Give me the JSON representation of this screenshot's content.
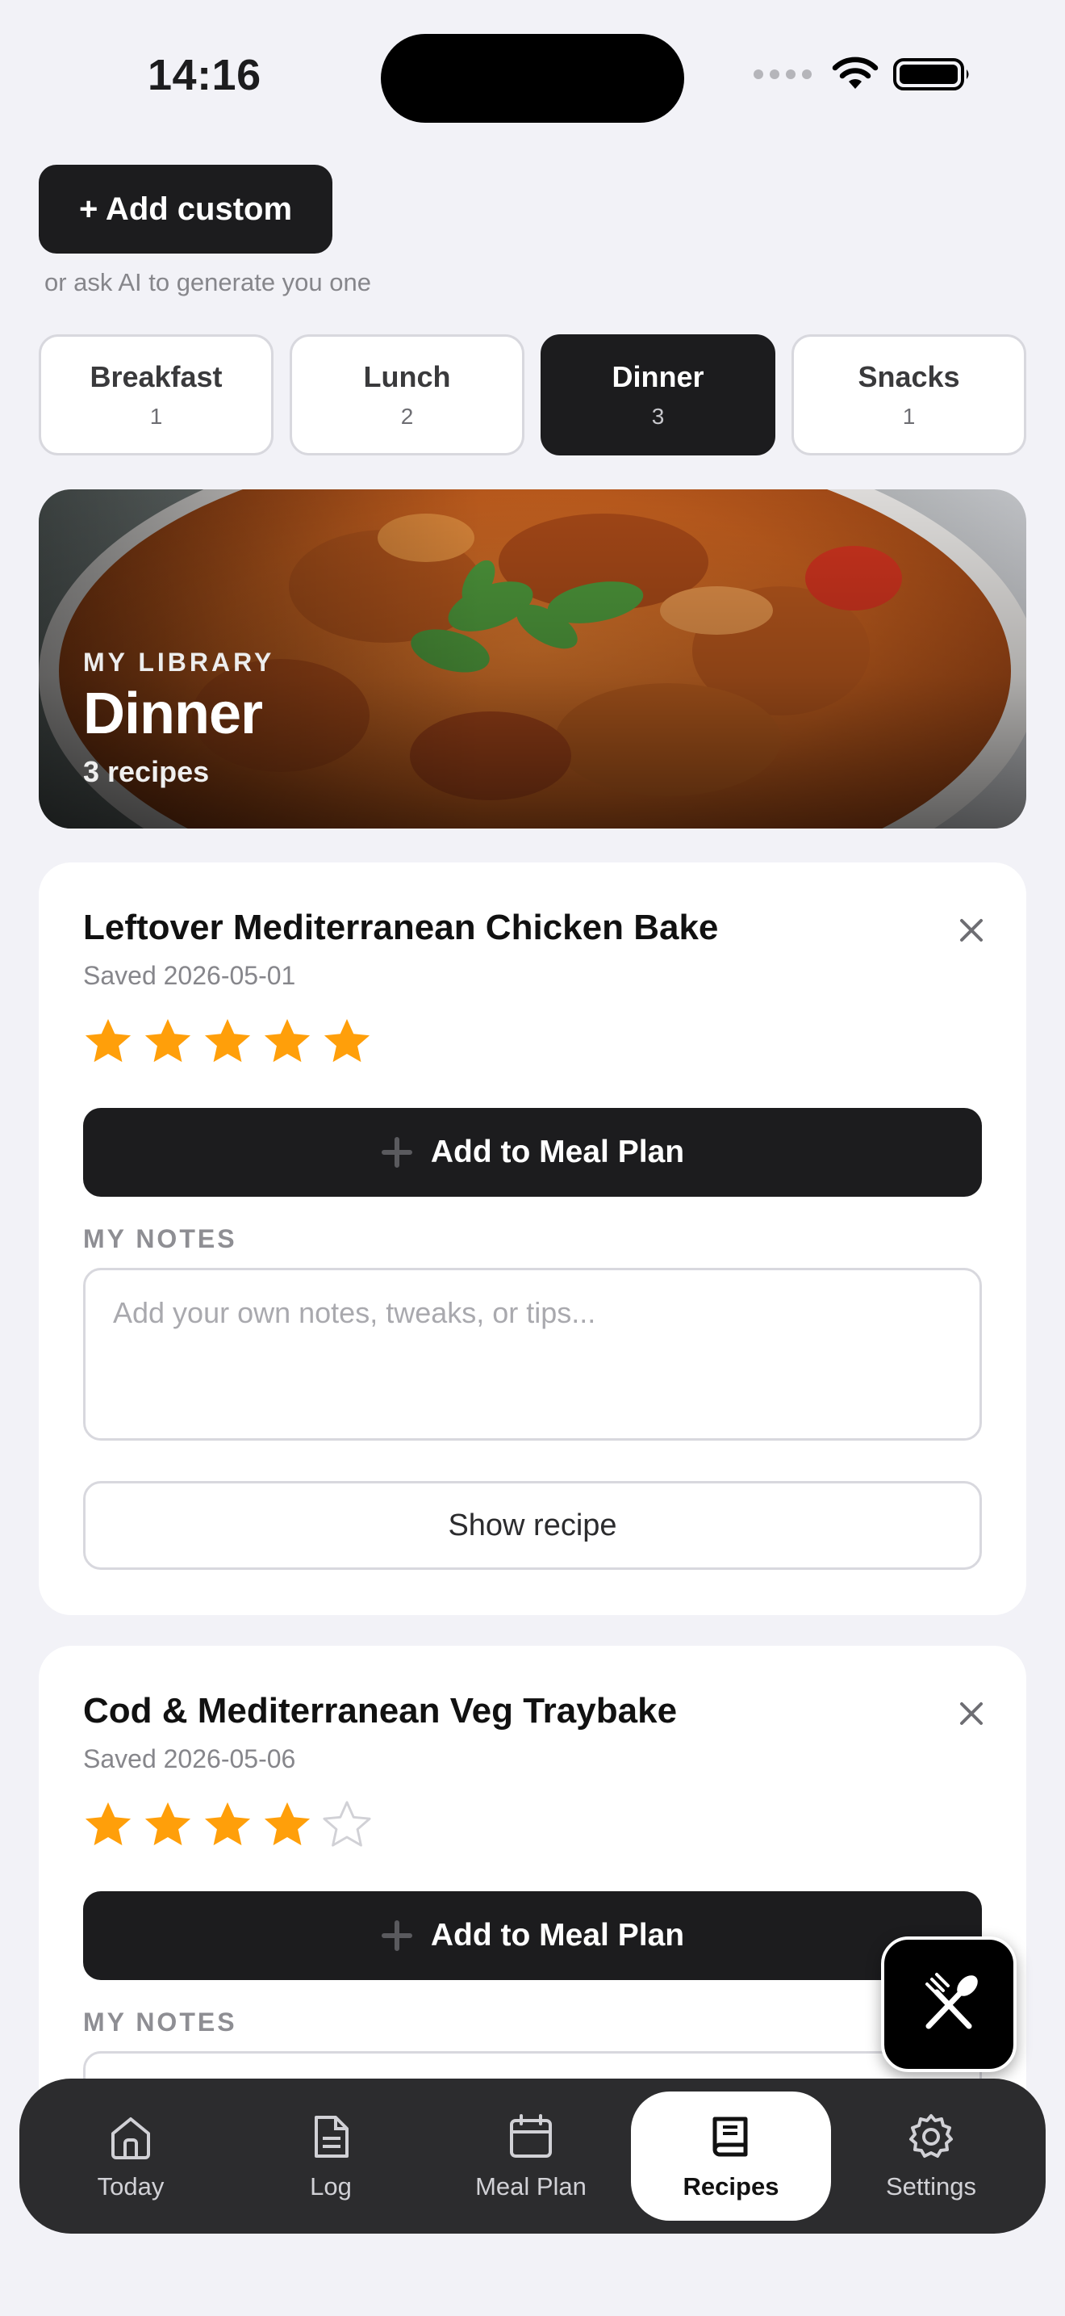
{
  "status_bar": {
    "time": "14:16"
  },
  "add_custom": {
    "label": "+ Add custom",
    "hint": "or ask AI to generate you one"
  },
  "categories": [
    {
      "label": "Breakfast",
      "count": "1",
      "active": false
    },
    {
      "label": "Lunch",
      "count": "2",
      "active": false
    },
    {
      "label": "Dinner",
      "count": "3",
      "active": true
    },
    {
      "label": "Snacks",
      "count": "1",
      "active": false
    }
  ],
  "hero": {
    "eyebrow": "MY LIBRARY",
    "title": "Dinner",
    "subtitle": "3 recipes"
  },
  "recipes": [
    {
      "title": "Leftover Mediterranean Chicken Bake",
      "saved": "Saved 2026-05-01",
      "rating": 5,
      "add_label": "Add to Meal Plan",
      "notes_heading": "MY NOTES",
      "notes_placeholder": "Add your own notes, tweaks, or tips...",
      "show_label": "Show recipe"
    },
    {
      "title": "Cod & Mediterranean Veg Traybake",
      "saved": "Saved 2026-05-06",
      "rating": 4,
      "add_label": "Add to Meal Plan",
      "notes_heading": "MY NOTES"
    }
  ],
  "rating_max": 5,
  "tabbar": [
    {
      "label": "Today",
      "icon": "home-icon",
      "active": false
    },
    {
      "label": "Log",
      "icon": "document-icon",
      "active": false
    },
    {
      "label": "Meal Plan",
      "icon": "calendar-icon",
      "active": false
    },
    {
      "label": "Recipes",
      "icon": "book-icon",
      "active": true
    },
    {
      "label": "Settings",
      "icon": "gear-icon",
      "active": false
    }
  ],
  "colors": {
    "background": "#F2F2F7",
    "primary": "#1C1C1E",
    "star": "#FF9F0A",
    "star_empty": "#D1D1D6",
    "tabbar": "#2C2C2E"
  }
}
